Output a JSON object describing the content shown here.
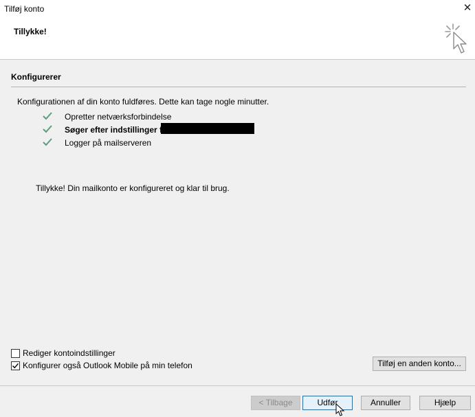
{
  "window": {
    "title": "Tilføj konto",
    "close_glyph": "✕"
  },
  "header": {
    "heading": "Tillykke!",
    "icon": "wizard-sparkle-cursor-icon"
  },
  "section": {
    "title": "Konfigurerer",
    "intro": "Konfigurationen af din konto fuldføres. Dette kan tage nogle minutter.",
    "tasks": [
      {
        "label": "Opretter netværksforbindelse",
        "status": "done"
      },
      {
        "label": "Søger efter indstillinger for",
        "status": "done"
      },
      {
        "label": "Logger på mailserveren",
        "status": "done"
      }
    ],
    "done_message": "Tillykke! Din mailkonto er konfigureret og klar til brug."
  },
  "options": [
    {
      "label": "Rediger kontoindstillinger",
      "checked": false
    },
    {
      "label": "Konfigurer også Outlook Mobile på min telefon",
      "checked": true
    }
  ],
  "buttons": {
    "add_another": "Tilføj en anden konto...",
    "back": "< Tilbage",
    "finish": "Udfør",
    "cancel": "Annuller",
    "help": "Hjælp"
  },
  "colors": {
    "check": "#5a9e7c",
    "accent": "#0078d7"
  }
}
